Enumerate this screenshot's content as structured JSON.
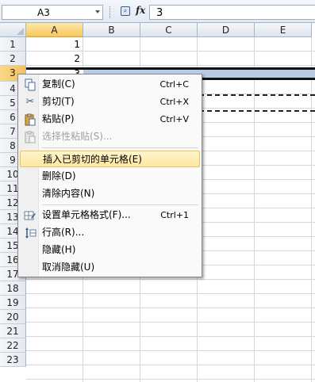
{
  "formula_bar": {
    "name_box": "A3",
    "fx_label": "fx",
    "formula_value": "3"
  },
  "columns": [
    "A",
    "B",
    "C",
    "D",
    "E"
  ],
  "rows": [
    "1",
    "2",
    "3",
    "4",
    "5",
    "6",
    "7",
    "8",
    "9",
    "10",
    "11",
    "12",
    "13",
    "14",
    "15",
    "16",
    "17",
    "18",
    "19",
    "20",
    "21",
    "22",
    "23"
  ],
  "cells": {
    "A1": "1",
    "A2": "2",
    "A3": "3"
  },
  "context_menu": {
    "items": [
      {
        "label": "复制(C)",
        "shortcut": "Ctrl+C",
        "icon": "copy-icon"
      },
      {
        "label": "剪切(T)",
        "shortcut": "Ctrl+X",
        "icon": "scissors-icon"
      },
      {
        "label": "粘贴(P)",
        "shortcut": "Ctrl+V",
        "icon": "paste-icon"
      },
      {
        "label": "选择性粘贴(S)...",
        "shortcut": "",
        "icon": "paste-special-icon",
        "disabled": true
      },
      {
        "label": "插入已剪切的单元格(E)",
        "shortcut": "",
        "highlight": true
      },
      {
        "label": "删除(D)",
        "shortcut": ""
      },
      {
        "label": "清除内容(N)",
        "shortcut": ""
      },
      {
        "label": "设置单元格格式(F)...",
        "shortcut": "Ctrl+1",
        "icon": "format-cells-icon"
      },
      {
        "label": "行高(R)...",
        "shortcut": "",
        "icon": "row-height-icon"
      },
      {
        "label": "隐藏(H)",
        "shortcut": ""
      },
      {
        "label": "取消隐藏(U)",
        "shortcut": ""
      }
    ]
  },
  "colors": {
    "header_border": "#9eb6ce",
    "selection_band": "#b7cbe6",
    "highlight_item": "#fde8a0"
  }
}
